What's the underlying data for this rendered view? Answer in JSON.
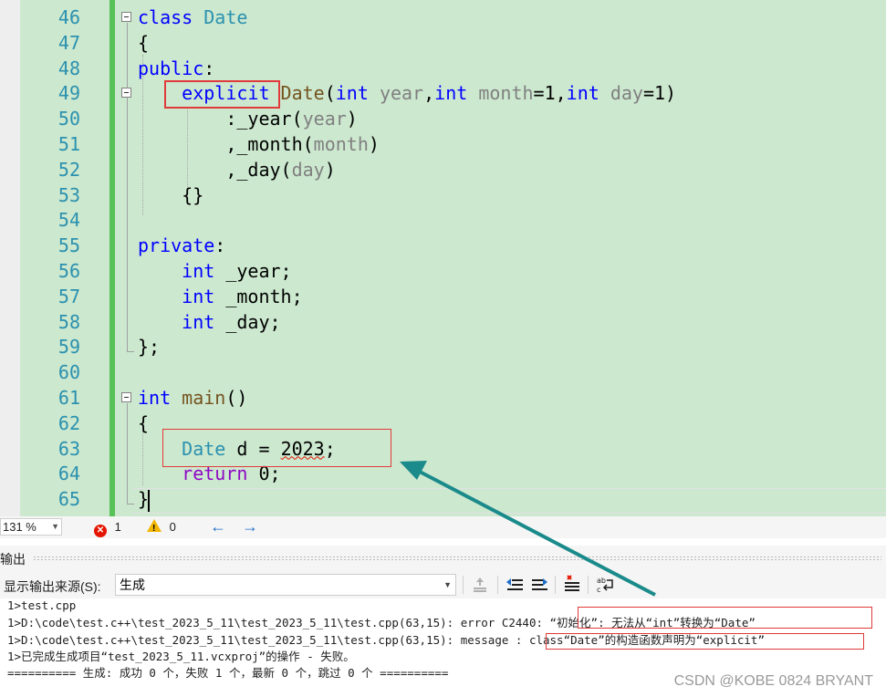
{
  "editor": {
    "line_numbers": [
      "46",
      "47",
      "48",
      "49",
      "50",
      "51",
      "52",
      "53",
      "54",
      "55",
      "56",
      "57",
      "58",
      "59",
      "60",
      "61",
      "62",
      "63",
      "64",
      "65"
    ],
    "lines": [
      [
        {
          "t": "class ",
          "c": "kw"
        },
        {
          "t": "Date",
          "c": "ty"
        }
      ],
      [
        {
          "t": "{",
          "c": ""
        }
      ],
      [
        {
          "t": "public",
          "c": "kw"
        },
        {
          "t": ":",
          "c": ""
        }
      ],
      [
        {
          "t": "    ",
          "c": ""
        },
        {
          "t": "explicit",
          "c": "kw"
        },
        {
          "t": " ",
          "c": ""
        },
        {
          "t": "Date",
          "c": "fn"
        },
        {
          "t": "(",
          "c": ""
        },
        {
          "t": "int",
          "c": "kw"
        },
        {
          "t": " ",
          "c": ""
        },
        {
          "t": "year",
          "c": "pr"
        },
        {
          "t": ",",
          "c": ""
        },
        {
          "t": "int",
          "c": "kw"
        },
        {
          "t": " ",
          "c": ""
        },
        {
          "t": "month",
          "c": "pr"
        },
        {
          "t": "=1,",
          "c": ""
        },
        {
          "t": "int",
          "c": "kw"
        },
        {
          "t": " ",
          "c": ""
        },
        {
          "t": "day",
          "c": "pr"
        },
        {
          "t": "=1)",
          "c": ""
        }
      ],
      [
        {
          "t": "        :_year(",
          "c": ""
        },
        {
          "t": "year",
          "c": "pr"
        },
        {
          "t": ")",
          "c": ""
        }
      ],
      [
        {
          "t": "        ,_month(",
          "c": ""
        },
        {
          "t": "month",
          "c": "pr"
        },
        {
          "t": ")",
          "c": ""
        }
      ],
      [
        {
          "t": "        ,_day(",
          "c": ""
        },
        {
          "t": "day",
          "c": "pr"
        },
        {
          "t": ")",
          "c": ""
        }
      ],
      [
        {
          "t": "    {}",
          "c": ""
        }
      ],
      [],
      [
        {
          "t": "private",
          "c": "kw"
        },
        {
          "t": ":",
          "c": ""
        }
      ],
      [
        {
          "t": "    ",
          "c": ""
        },
        {
          "t": "int",
          "c": "kw"
        },
        {
          "t": " _year;",
          "c": ""
        }
      ],
      [
        {
          "t": "    ",
          "c": ""
        },
        {
          "t": "int",
          "c": "kw"
        },
        {
          "t": " _month;",
          "c": ""
        }
      ],
      [
        {
          "t": "    ",
          "c": ""
        },
        {
          "t": "int",
          "c": "kw"
        },
        {
          "t": " _day;",
          "c": ""
        }
      ],
      [
        {
          "t": "};",
          "c": ""
        }
      ],
      [],
      [
        {
          "t": "int",
          "c": "kw"
        },
        {
          "t": " ",
          "c": ""
        },
        {
          "t": "main",
          "c": "fn"
        },
        {
          "t": "()",
          "c": ""
        }
      ],
      [
        {
          "t": "{",
          "c": ""
        }
      ],
      [
        {
          "t": "    ",
          "c": ""
        },
        {
          "t": "Date",
          "c": "ty"
        },
        {
          "t": " d = ",
          "c": ""
        },
        {
          "t": "2023",
          "c": "squiggle"
        },
        {
          "t": ";",
          "c": ""
        }
      ],
      [
        {
          "t": "    ",
          "c": ""
        },
        {
          "t": "return",
          "c": "kw2"
        },
        {
          "t": " 0;",
          "c": ""
        }
      ],
      [
        {
          "t": "}",
          "c": ""
        }
      ]
    ]
  },
  "status_bar": {
    "zoom": "131 %",
    "errors": "1",
    "warnings": "0",
    "back_arrow": "←",
    "forward_arrow": "→"
  },
  "output": {
    "title": "输出",
    "source_label": "显示输出来源(S):",
    "source_value": "生成",
    "lines": [
      "1>test.cpp",
      "1>D:\\code\\test.c++\\test_2023_5_11\\test_2023_5_11\\test.cpp(63,15): error C2440: “初始化”: 无法从“int”转换为“Date”",
      "1>D:\\code\\test.c++\\test_2023_5_11\\test_2023_5_11\\test.cpp(63,15): message : class“Date”的构造函数声明为“explicit”",
      "1>已完成生成项目“test_2023_5_11.vcxproj”的操作 - 失败。",
      "========== 生成: 成功 0 个，失败 1 个，最新 0 个，跳过 0 个 =========="
    ]
  },
  "watermark": "CSDN @KOBE 0824 BRYANT",
  "colors": {
    "editor_bg": "#cce8cf",
    "annotation_red": "#e03a3a",
    "annotation_arrow": "#1a8a8a"
  }
}
